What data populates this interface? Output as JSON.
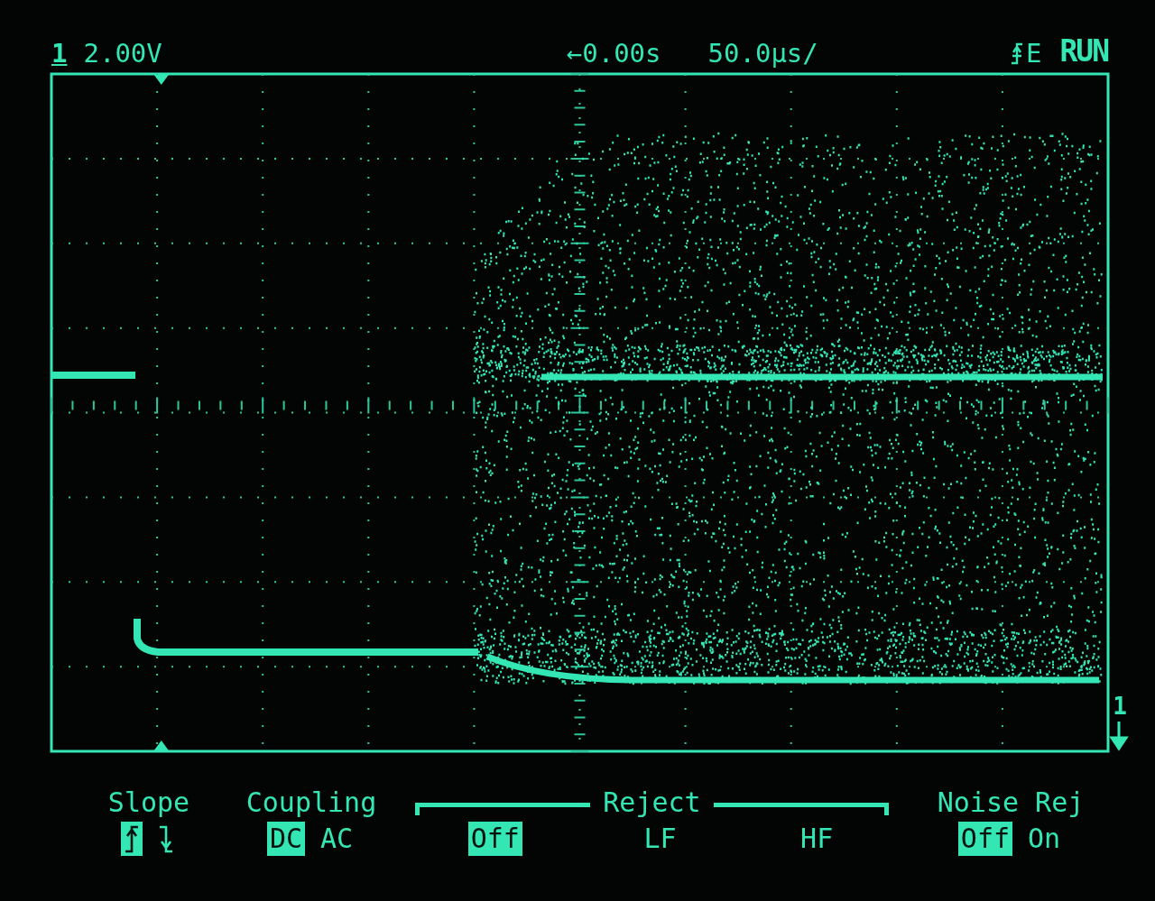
{
  "header": {
    "channel": "1",
    "volts_per_div": "2.00V",
    "delay": "←0.00s",
    "time_per_div": "50.0µs/",
    "trigger_source": "E",
    "run_state": "RUN"
  },
  "marker_label": "1",
  "softkeys": [
    {
      "title": "Slope",
      "kind": "plain",
      "options": [
        {
          "kind": "rising-edge",
          "selected": true
        },
        {
          "kind": "falling-edge",
          "selected": false
        }
      ]
    },
    {
      "title": "Coupling",
      "kind": "plain",
      "options": [
        {
          "kind": "text",
          "label": "DC",
          "selected": true
        },
        {
          "kind": "text",
          "label": "AC",
          "selected": false
        }
      ]
    },
    {
      "title": "Reject",
      "kind": "bracket",
      "options": [
        {
          "kind": "text",
          "label": "Off",
          "selected": true
        },
        {
          "kind": "text",
          "label": "LF",
          "selected": false
        },
        {
          "kind": "text",
          "label": "HF",
          "selected": false
        }
      ]
    },
    {
      "title": "Noise Rej",
      "kind": "plain",
      "options": [
        {
          "kind": "text",
          "label": "Off",
          "selected": true
        },
        {
          "kind": "text",
          "label": "On",
          "selected": false
        }
      ]
    }
  ]
}
